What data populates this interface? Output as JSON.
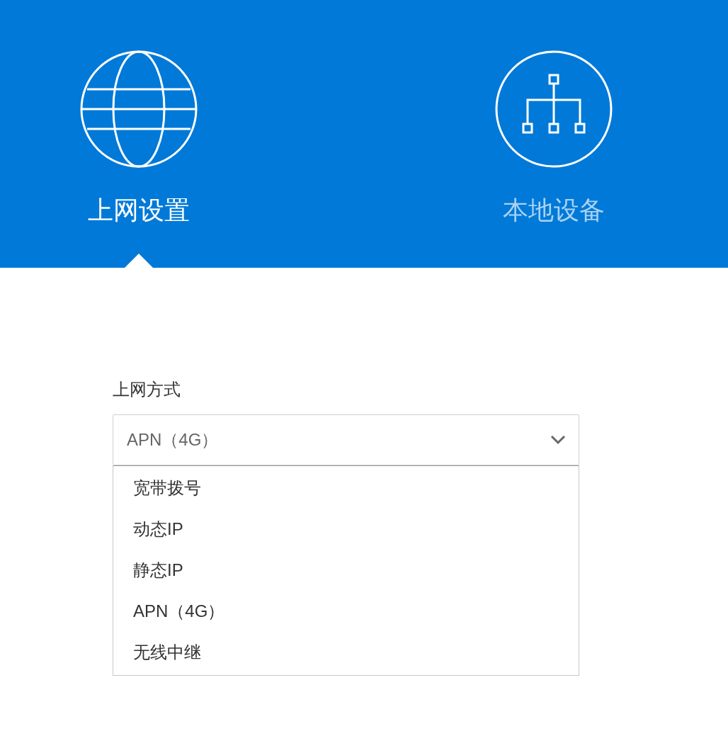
{
  "tabs": [
    {
      "label": "上网设置",
      "selected": true,
      "kind": "globe"
    },
    {
      "label": "本地设备",
      "selected": false,
      "kind": "network"
    }
  ],
  "form": {
    "label": "上网方式",
    "value": "APN（4G）",
    "expanded": true,
    "options": [
      "宽带拨号",
      "动态IP",
      "静态IP",
      "APN（4G）",
      "无线中继"
    ]
  }
}
